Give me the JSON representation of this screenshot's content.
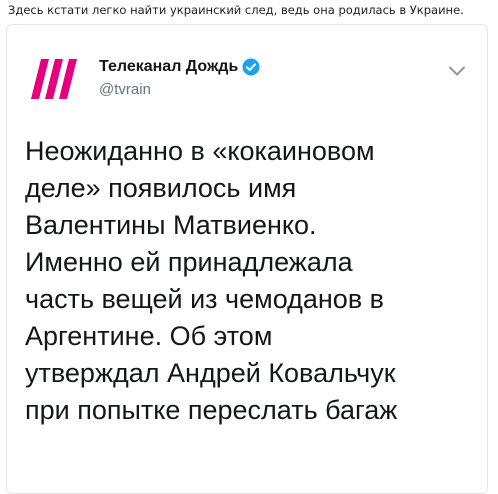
{
  "caption": "Здесь кстати легко найти украинский след, ведь она родилась в Украине.",
  "tweet": {
    "author_name": "Телеканал Дождь",
    "handle": "@tvrain",
    "verified_icon": "verified-badge-icon",
    "menu_icon": "chevron-down-icon",
    "avatar_icon": "tvrain-logo-slashes",
    "text": "Неожиданно в «кокаиновом\nделе» появилось имя\nВалентины Матвиенко.\nИменно ей принадлежала\nчасть вещей из чемоданов в\nАргентине. Об этом\nутверждал Андрей Ковальчук\nпри попытке переслать багаж"
  },
  "colors": {
    "logo_pink": "#e6007e",
    "verified_blue": "#1da1f2",
    "text": "#14171a",
    "secondary_text": "#657786",
    "border": "#e1e8ed"
  }
}
